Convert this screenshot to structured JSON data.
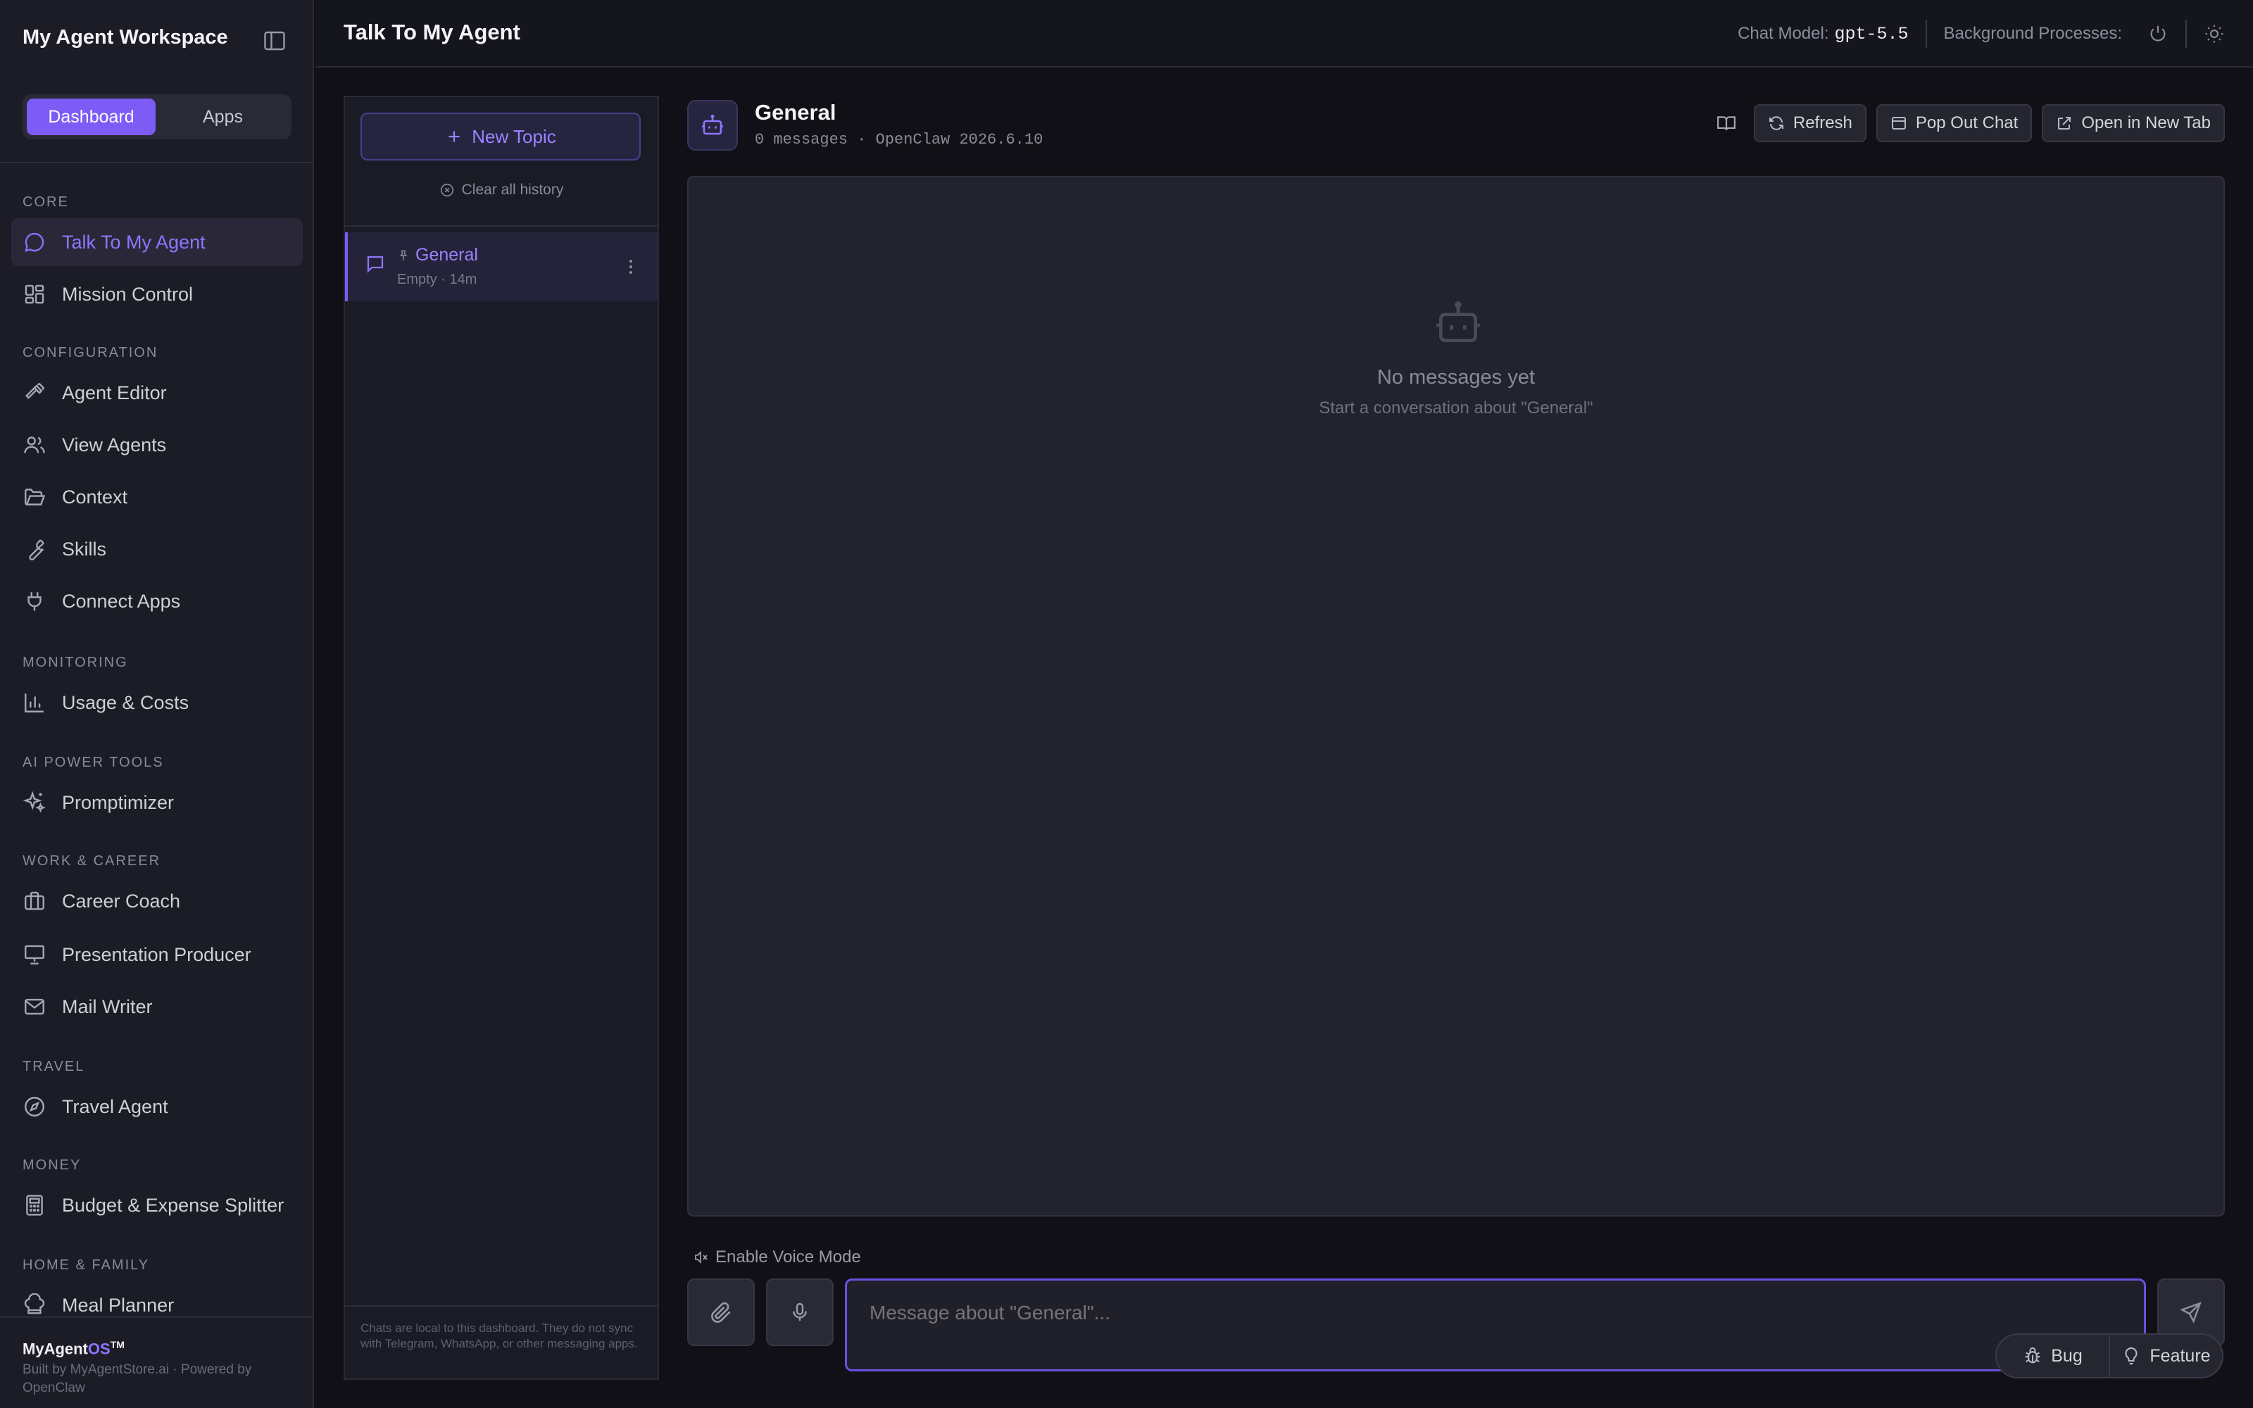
{
  "sidebar": {
    "workspace_title": "My Agent Workspace",
    "tabs": [
      {
        "label": "Dashboard",
        "active": true
      },
      {
        "label": "Apps",
        "active": false
      }
    ],
    "sections": [
      {
        "label": "CORE",
        "items": [
          {
            "label": "Talk To My Agent",
            "icon": "chat-bubble-icon",
            "active": true
          },
          {
            "label": "Mission Control",
            "icon": "dashboard-grid-icon"
          }
        ]
      },
      {
        "label": "CONFIGURATION",
        "items": [
          {
            "label": "Agent Editor",
            "icon": "hammer-icon"
          },
          {
            "label": "View Agents",
            "icon": "users-icon"
          },
          {
            "label": "Context",
            "icon": "folder-open-icon"
          },
          {
            "label": "Skills",
            "icon": "wrench-icon"
          },
          {
            "label": "Connect Apps",
            "icon": "plug-icon"
          }
        ]
      },
      {
        "label": "MONITORING",
        "items": [
          {
            "label": "Usage & Costs",
            "icon": "bar-chart-icon"
          }
        ]
      },
      {
        "label": "AI POWER TOOLS",
        "items": [
          {
            "label": "Promptimizer",
            "icon": "sparkles-icon"
          }
        ]
      },
      {
        "label": "WORK & CAREER",
        "items": [
          {
            "label": "Career Coach",
            "icon": "briefcase-icon"
          },
          {
            "label": "Presentation Producer",
            "icon": "presentation-icon"
          },
          {
            "label": "Mail Writer",
            "icon": "mail-icon"
          }
        ]
      },
      {
        "label": "TRAVEL",
        "items": [
          {
            "label": "Travel Agent",
            "icon": "compass-icon"
          }
        ]
      },
      {
        "label": "MONEY",
        "items": [
          {
            "label": "Budget & Expense Splitter",
            "icon": "calculator-icon"
          }
        ]
      },
      {
        "label": "HOME & FAMILY",
        "items": [
          {
            "label": "Meal Planner",
            "icon": "chef-hat-icon"
          }
        ]
      }
    ],
    "footer": {
      "brand_main": "MyAgent",
      "brand_os": "OS",
      "brand_tm": "TM",
      "built_by": "Built by MyAgentStore.ai · Powered by OpenClaw"
    }
  },
  "topbar": {
    "title": "Talk To My Agent",
    "chat_model_label": "Chat Model:",
    "chat_model_value": "gpt-5.5",
    "background_label": "Background Processes:"
  },
  "topics": {
    "new_topic_label": "New Topic",
    "clear_history_label": "Clear all history",
    "items": [
      {
        "name": "General",
        "meta": "Empty · 14m",
        "active": true
      }
    ],
    "footer_note": "Chats are local to this dashboard. They do not sync with Telegram, WhatsApp, or other messaging apps."
  },
  "chat": {
    "title": "General",
    "subtitle": "0 messages · OpenClaw 2026.6.10",
    "actions": {
      "refresh": "Refresh",
      "pop_out": "Pop Out Chat",
      "open_tab": "Open in New Tab"
    },
    "empty_title": "No messages yet",
    "empty_subtitle": "Start a conversation about \"General\"",
    "voice_mode_label": "Enable Voice Mode",
    "input_placeholder": "Message about \"General\"..."
  },
  "feedback": {
    "bug_label": "Bug",
    "feature_label": "Feature"
  },
  "colors": {
    "accent": "#7c5cf5",
    "accent_text": "#8f75ff",
    "background": "#101016",
    "sidebar": "#1c1c26"
  }
}
